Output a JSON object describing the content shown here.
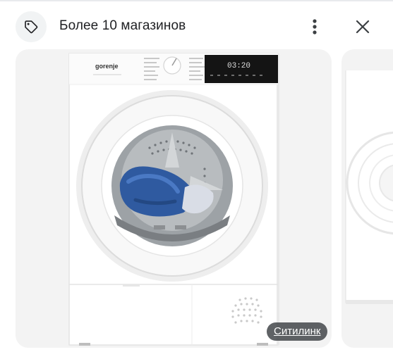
{
  "header": {
    "title": "Более 10 магазинов",
    "tag_icon": "tag-icon",
    "more_icon": "more-vert-icon",
    "close_icon": "close-icon"
  },
  "product": {
    "brand_logo": "gorenje",
    "display_time": "03:20",
    "source_label": "Ситилинк"
  },
  "colors": {
    "accent_badge": "#3c4043",
    "title_text": "#202124",
    "card_bg": "#f3f3f3"
  }
}
